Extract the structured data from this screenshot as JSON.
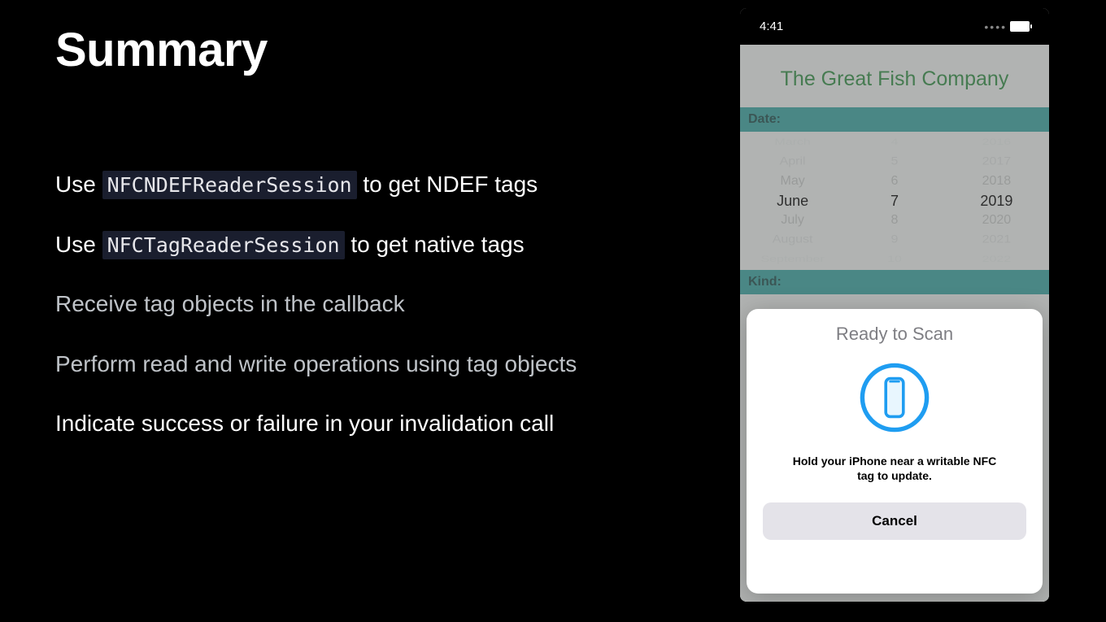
{
  "title": "Summary",
  "bullets": [
    {
      "prefix": "Use ",
      "code": "NFCNDEFReaderSession",
      "suffix": " to get NDEF tags",
      "bright": true
    },
    {
      "prefix": "Use ",
      "code": "NFCTagReaderSession",
      "suffix": " to get native tags",
      "bright": true
    },
    {
      "prefix": "Receive tag objects in the callback",
      "code": "",
      "suffix": "",
      "bright": false
    },
    {
      "prefix": "Perform read and write operations using tag objects",
      "code": "",
      "suffix": "",
      "bright": false
    },
    {
      "prefix": "Indicate success or failure in your invalidation call",
      "code": "",
      "suffix": "",
      "bright": true
    }
  ],
  "phone": {
    "time": "4:41",
    "app_title": "The Great Fish Company",
    "section_date": "Date:",
    "section_kind": "Kind:",
    "picker": {
      "months": [
        "March",
        "April",
        "May",
        "June",
        "July",
        "August",
        "September"
      ],
      "days": [
        "4",
        "5",
        "6",
        "7",
        "8",
        "9",
        "10"
      ],
      "years": [
        "2016",
        "2017",
        "2018",
        "2019",
        "2020",
        "2021",
        "2022"
      ]
    },
    "nfc": {
      "title": "Ready to Scan",
      "message": "Hold your iPhone near a writable NFC tag to update.",
      "cancel": "Cancel"
    }
  }
}
